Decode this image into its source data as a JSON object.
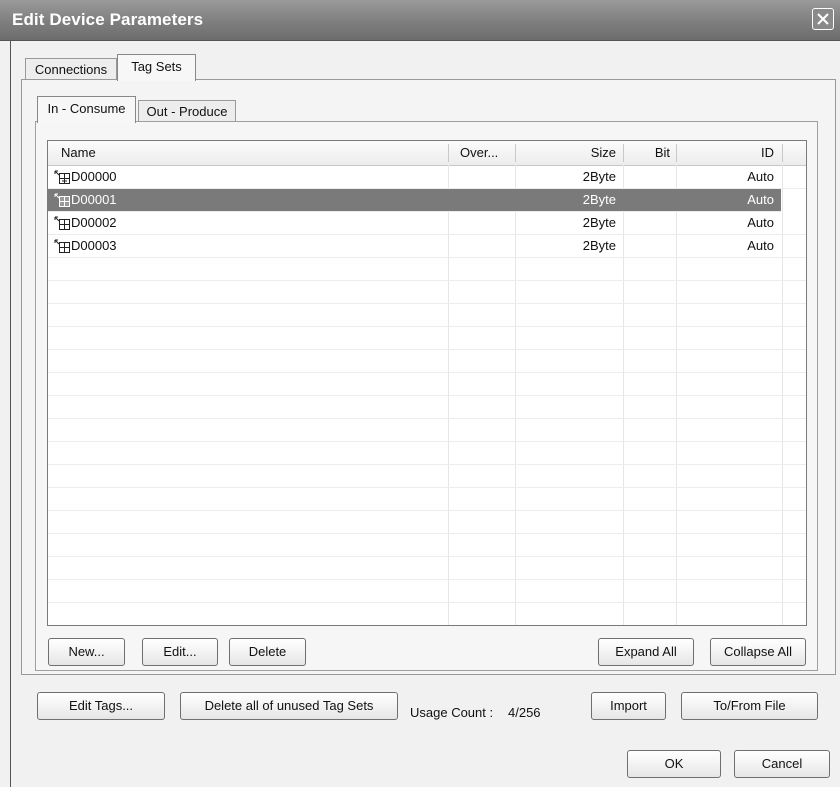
{
  "window": {
    "title": "Edit Device Parameters"
  },
  "outer_tabs": [
    {
      "label": "Connections",
      "active": false
    },
    {
      "label": "Tag Sets",
      "active": true
    }
  ],
  "inner_tabs": [
    {
      "label": "In - Consume",
      "active": true
    },
    {
      "label": "Out - Produce",
      "active": false
    }
  ],
  "table": {
    "columns": [
      "Name",
      "Over...",
      "Size",
      "Bit",
      "ID"
    ],
    "rows": [
      {
        "name": "D00000",
        "over": "",
        "size": "2Byte",
        "bit": "",
        "id": "Auto",
        "selected": false
      },
      {
        "name": "D00001",
        "over": "",
        "size": "2Byte",
        "bit": "",
        "id": "Auto",
        "selected": true
      },
      {
        "name": "D00002",
        "over": "",
        "size": "2Byte",
        "bit": "",
        "id": "Auto",
        "selected": false
      },
      {
        "name": "D00003",
        "over": "",
        "size": "2Byte",
        "bit": "",
        "id": "Auto",
        "selected": false
      }
    ],
    "row_icon": "tag-set-expand-icon"
  },
  "list_buttons": {
    "new": "New...",
    "edit": "Edit...",
    "delete": "Delete",
    "expand_all": "Expand All",
    "collapse_all": "Collapse All"
  },
  "bottom": {
    "edit_tags": "Edit Tags...",
    "delete_unused": "Delete all of unused Tag Sets",
    "usage_label": "Usage Count :",
    "usage_value": "4/256",
    "import": "Import",
    "to_from_file": "To/From File"
  },
  "dialog_buttons": {
    "ok": "OK",
    "cancel": "Cancel"
  },
  "colors": {
    "titlebar": "#7c7c7c",
    "selection": "#7a7a7a",
    "background": "#f1f1f1"
  }
}
